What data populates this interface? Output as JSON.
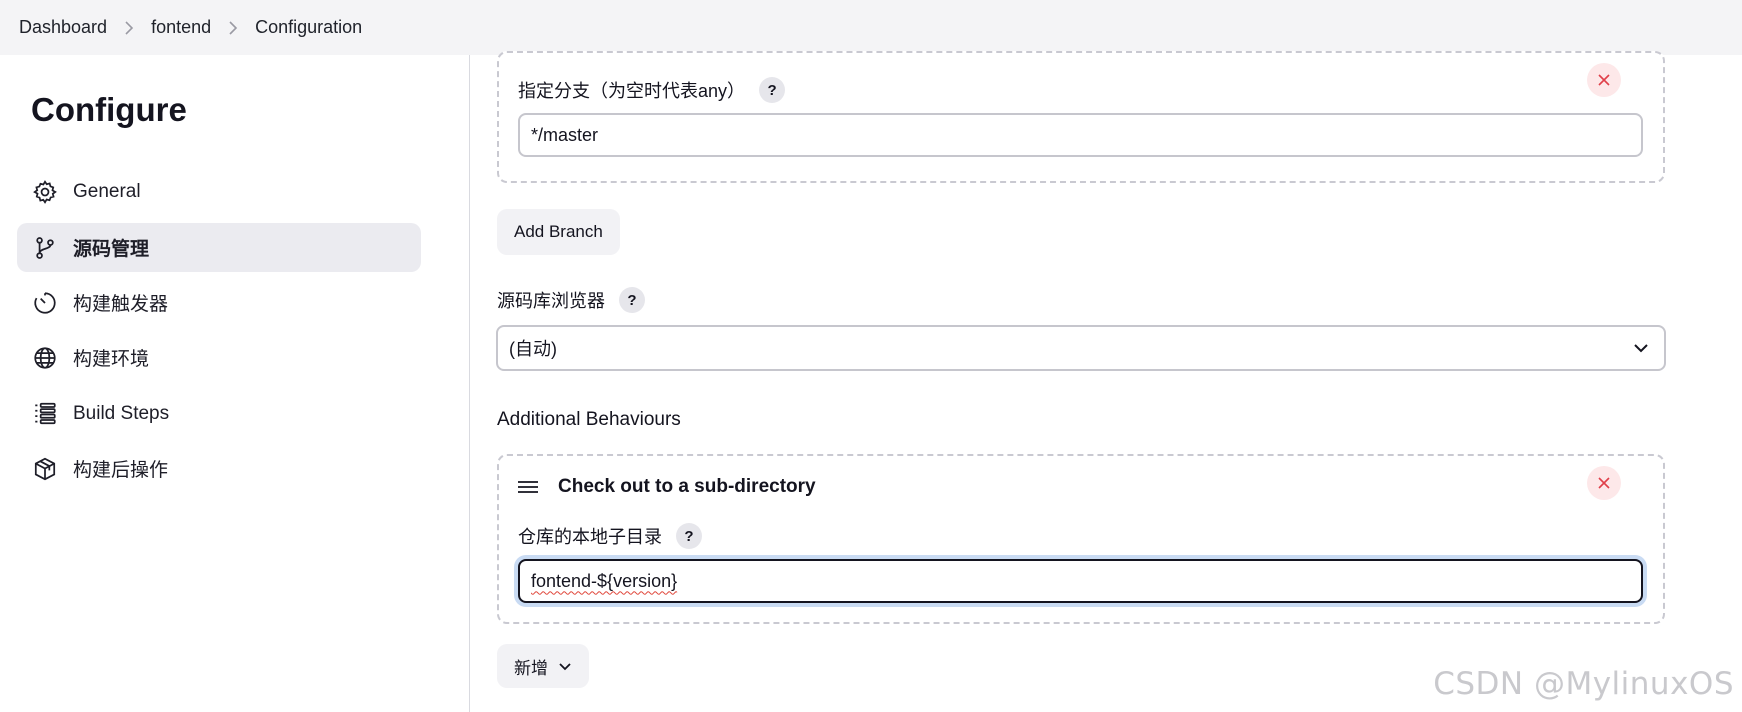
{
  "breadcrumb": {
    "items": [
      "Dashboard",
      "fontend",
      "Configuration"
    ]
  },
  "sidebar": {
    "title": "Configure",
    "items": [
      {
        "label": "General",
        "icon": "gear-icon",
        "active": false
      },
      {
        "label": "源码管理",
        "icon": "branch-icon",
        "active": true
      },
      {
        "label": "构建触发器",
        "icon": "clock-icon",
        "active": false
      },
      {
        "label": "构建环境",
        "icon": "globe-icon",
        "active": false
      },
      {
        "label": "Build Steps",
        "icon": "list-icon",
        "active": false
      },
      {
        "label": "构建后操作",
        "icon": "package-icon",
        "active": false
      }
    ]
  },
  "main": {
    "branch": {
      "label": "指定分支（为空时代表any）",
      "help": "?",
      "value": "*/master"
    },
    "add_branch_label": "Add Branch",
    "repo_browser": {
      "label": "源码库浏览器",
      "help": "?",
      "selected": "(自动)"
    },
    "additional_behaviours": {
      "heading": "Additional Behaviours",
      "item": {
        "title": "Check out to a sub-directory",
        "field_label": "仓库的本地子目录",
        "help": "?",
        "value": "fontend-${version}"
      }
    },
    "add_label": "新增"
  },
  "watermark": "CSDN @MylinuxOS",
  "colors": {
    "topbar_bg": "#f4f4f6",
    "active_item_bg": "#ebebf0",
    "close_bg": "#fde8e9",
    "close_x": "#e0404a",
    "focus_ring": "#c9dbf3"
  }
}
